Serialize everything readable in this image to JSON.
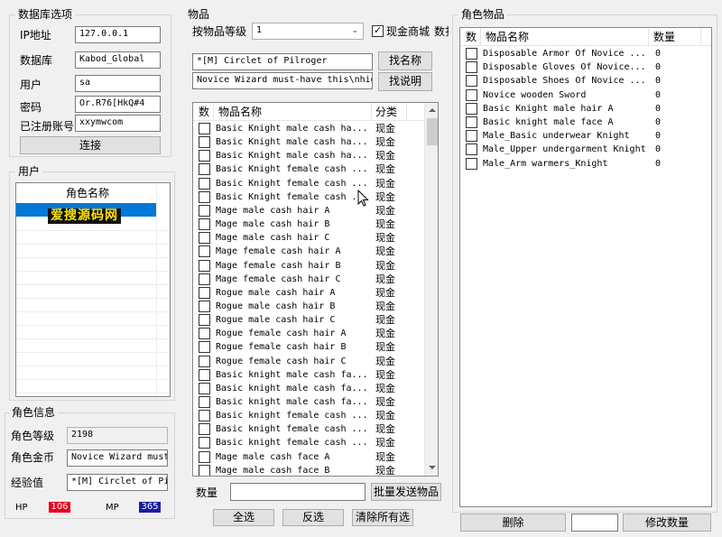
{
  "db": {
    "title": "数据库选项",
    "ip_label": "IP地址",
    "ip_value": "127.0.0.1",
    "db_label": "数据库",
    "db_value": "Kabod_Global",
    "user_label": "用户",
    "user_value": "sa",
    "pwd_label": "密码",
    "pwd_value": "Or.R76[HkQ#4",
    "acct_label": "已注册账号",
    "acct_value": "xxymwcom",
    "connect_label": "连接"
  },
  "users": {
    "title": "用户",
    "col_name": "角色名称",
    "watermark": "爱搜源码网"
  },
  "char_info": {
    "title": "角色信息",
    "level_label": "角色等级",
    "level_value": "2198",
    "gold_label": "角色金币",
    "gold_value": "Novice Wizard must",
    "exp_label": "经验值",
    "exp_value": "*[M] Circlet of Pil",
    "hp_label": "HP",
    "hp_value": "106",
    "mp_label": "MP",
    "mp_value": "365",
    "hp_color": "#e8001c",
    "mp_color": "#1a1aa8"
  },
  "items": {
    "title": "物品",
    "by_level_label": "按物品等级",
    "level_select": "1",
    "cash_shop_label": "现金商城",
    "cash_shop_checked": true,
    "truncated_label": "数扎",
    "search_name_value": "*[M] Circlet of Pilroger",
    "search_desc_value": "Novice Wizard must-have this\\nhigh",
    "find_name_btn": "找名称",
    "find_desc_btn": "找说明",
    "col_check": "数",
    "col_name": "物品名称",
    "col_cat": "分类",
    "rows": [
      {
        "name": "Basic Knight male cash ha...",
        "cat": "现金"
      },
      {
        "name": "Basic Knight male cash ha...",
        "cat": "现金"
      },
      {
        "name": "Basic Knight male cash ha...",
        "cat": "现金"
      },
      {
        "name": "Basic Knight female cash ...",
        "cat": "现金"
      },
      {
        "name": "Basic Knight female cash ...",
        "cat": "现金"
      },
      {
        "name": "Basic Knight female cash ...",
        "cat": "现金"
      },
      {
        "name": "Mage male cash hair A",
        "cat": "现金"
      },
      {
        "name": "Mage male cash hair B",
        "cat": "现金"
      },
      {
        "name": "Mage male cash hair C",
        "cat": "现金"
      },
      {
        "name": "Mage female cash hair A",
        "cat": "现金"
      },
      {
        "name": "Mage female cash hair B",
        "cat": "现金"
      },
      {
        "name": "Mage female cash hair C",
        "cat": "现金"
      },
      {
        "name": "Rogue male cash hair A",
        "cat": "现金"
      },
      {
        "name": "Rogue male cash hair B",
        "cat": "现金"
      },
      {
        "name": "Rogue male cash hair C",
        "cat": "现金"
      },
      {
        "name": "Rogue female cash hair A",
        "cat": "现金"
      },
      {
        "name": "Rogue female cash hair B",
        "cat": "现金"
      },
      {
        "name": "Rogue female cash hair C",
        "cat": "现金"
      },
      {
        "name": "Basic knight male cash fa...",
        "cat": "现金"
      },
      {
        "name": "Basic knight male cash fa...",
        "cat": "现金"
      },
      {
        "name": "Basic knight male cash fa...",
        "cat": "现金"
      },
      {
        "name": "Basic knight female cash ...",
        "cat": "现金"
      },
      {
        "name": "Basic knight female cash ...",
        "cat": "现金"
      },
      {
        "name": "Basic knight female cash ...",
        "cat": "现金"
      },
      {
        "name": "Mage male cash face A",
        "cat": "现金"
      },
      {
        "name": "Mage male cash face B",
        "cat": "现金"
      }
    ],
    "qty_label": "数量",
    "qty_value": "",
    "batch_send_btn": "批量发送物品",
    "select_all_btn": "全选",
    "invert_btn": "反选",
    "clear_btn": "清除所有选"
  },
  "char_items": {
    "title": "角色物品",
    "col_check": "数",
    "col_name": "物品名称",
    "col_qty": "数量",
    "rows": [
      {
        "name": "Disposable Armor Of Novice ...",
        "qty": "0"
      },
      {
        "name": "Disposable Gloves Of Novice...",
        "qty": "0"
      },
      {
        "name": "Disposable Shoes Of Novice ...",
        "qty": "0"
      },
      {
        "name": "Novice wooden Sword",
        "qty": "0"
      },
      {
        "name": "Basic Knight male hair A",
        "qty": "0"
      },
      {
        "name": "Basic knight male face A",
        "qty": "0"
      },
      {
        "name": "Male_Basic underwear Knight",
        "qty": "0"
      },
      {
        "name": "Male_Upper undergarment Knight",
        "qty": "0"
      },
      {
        "name": "Male_Arm warmers_Knight",
        "qty": "0"
      }
    ],
    "delete_btn": "删除",
    "qty_edit_value": "",
    "modify_qty_btn": "修改数量"
  }
}
